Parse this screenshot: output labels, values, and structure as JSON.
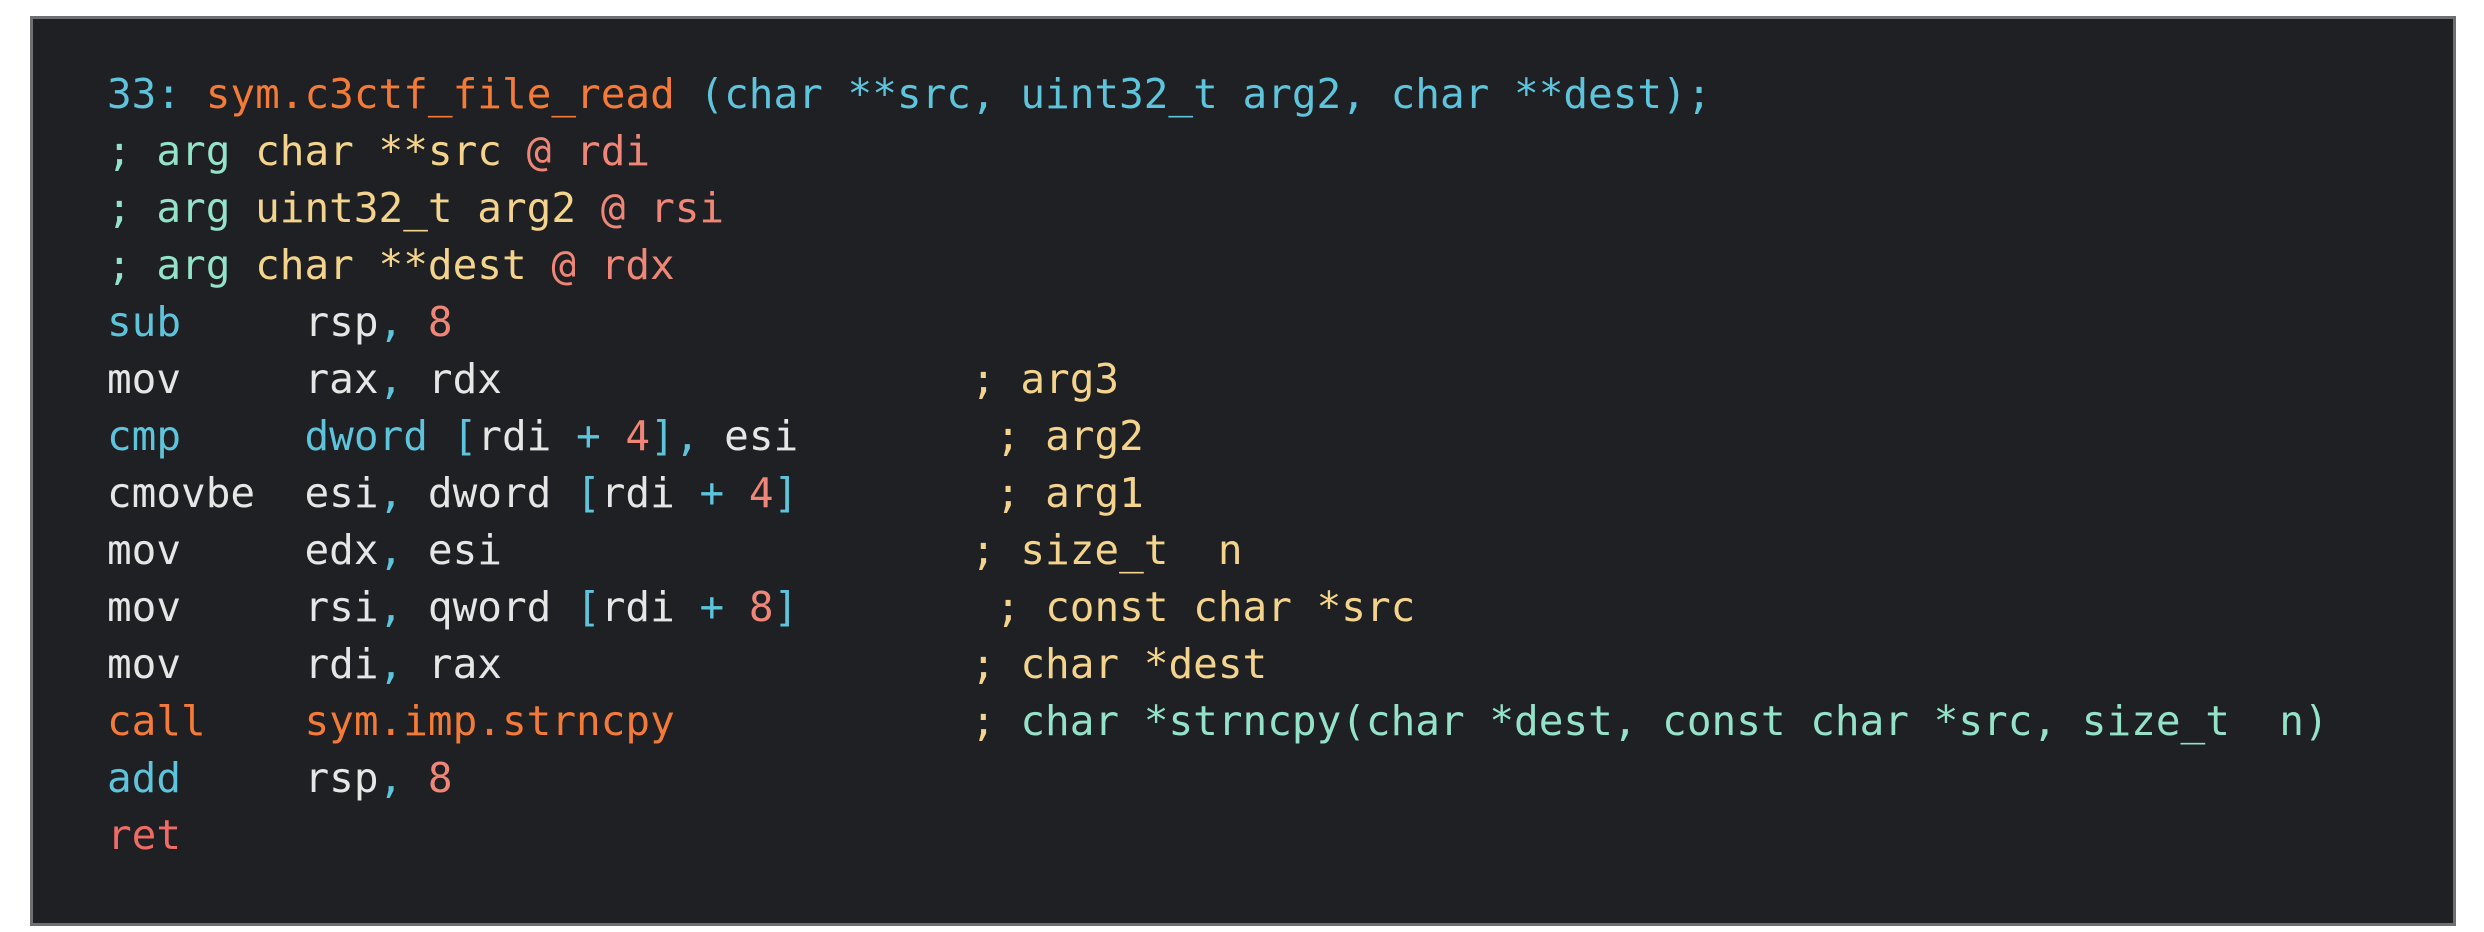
{
  "colors": {
    "background": "#1e2023",
    "border": "#6d6f72",
    "cyan": "#5ec4dc",
    "orange": "#f47a38",
    "white": "#e6e6e6",
    "mint": "#94e2c8",
    "yellow": "#f4d48c",
    "salmon": "#ef8677",
    "red": "#ee6b66"
  },
  "disassembly": {
    "lines": [
      {
        "kind": "header",
        "tokens": [
          {
            "text": "33: ",
            "color": "cyan"
          },
          {
            "text": "sym.c3ctf_file_read",
            "color": "orange"
          },
          {
            "text": " (char **src, uint32_t arg2, char **dest);",
            "color": "cyan"
          }
        ]
      },
      {
        "kind": "arg",
        "tokens": [
          {
            "text": "; arg ",
            "color": "mint"
          },
          {
            "text": "char **src",
            "color": "yellow"
          },
          {
            "text": " @ rdi",
            "color": "salmon"
          }
        ]
      },
      {
        "kind": "arg",
        "tokens": [
          {
            "text": "; arg ",
            "color": "mint"
          },
          {
            "text": "uint32_t arg2",
            "color": "yellow"
          },
          {
            "text": " @ rsi",
            "color": "salmon"
          }
        ]
      },
      {
        "kind": "arg",
        "tokens": [
          {
            "text": "; arg ",
            "color": "mint"
          },
          {
            "text": "char **dest",
            "color": "yellow"
          },
          {
            "text": " @ rdx",
            "color": "salmon"
          }
        ]
      },
      {
        "kind": "instruction",
        "tokens": [
          {
            "text": "sub",
            "color": "cyan"
          },
          {
            "text": "     ",
            "color": "white"
          },
          {
            "text": "rsp",
            "color": "white"
          },
          {
            "text": ", ",
            "color": "cyan"
          },
          {
            "text": "8",
            "color": "salmon"
          }
        ]
      },
      {
        "kind": "instruction",
        "tokens": [
          {
            "text": "mov",
            "color": "white"
          },
          {
            "text": "     ",
            "color": "white"
          },
          {
            "text": "rax",
            "color": "white"
          },
          {
            "text": ", ",
            "color": "cyan"
          },
          {
            "text": "rdx",
            "color": "white"
          },
          {
            "text": "                   ",
            "color": "white"
          },
          {
            "text": "; ",
            "color": "yellow"
          },
          {
            "text": "arg3",
            "color": "yellow"
          }
        ]
      },
      {
        "kind": "instruction",
        "tokens": [
          {
            "text": "cmp",
            "color": "cyan"
          },
          {
            "text": "     ",
            "color": "white"
          },
          {
            "text": "dword",
            "color": "cyan"
          },
          {
            "text": " [",
            "color": "cyan"
          },
          {
            "text": "rdi",
            "color": "white"
          },
          {
            "text": " + ",
            "color": "cyan"
          },
          {
            "text": "4",
            "color": "salmon"
          },
          {
            "text": "], ",
            "color": "cyan"
          },
          {
            "text": "esi",
            "color": "white"
          },
          {
            "text": "        ",
            "color": "white"
          },
          {
            "text": "; ",
            "color": "yellow"
          },
          {
            "text": "arg2",
            "color": "yellow"
          }
        ]
      },
      {
        "kind": "instruction",
        "tokens": [
          {
            "text": "cmovbe",
            "color": "white"
          },
          {
            "text": "  ",
            "color": "white"
          },
          {
            "text": "esi",
            "color": "white"
          },
          {
            "text": ", ",
            "color": "cyan"
          },
          {
            "text": "dword",
            "color": "white"
          },
          {
            "text": " [",
            "color": "cyan"
          },
          {
            "text": "rdi",
            "color": "white"
          },
          {
            "text": " + ",
            "color": "cyan"
          },
          {
            "text": "4",
            "color": "salmon"
          },
          {
            "text": "]",
            "color": "cyan"
          },
          {
            "text": "        ",
            "color": "white"
          },
          {
            "text": "; ",
            "color": "yellow"
          },
          {
            "text": "arg1",
            "color": "yellow"
          }
        ]
      },
      {
        "kind": "instruction",
        "tokens": [
          {
            "text": "mov",
            "color": "white"
          },
          {
            "text": "     ",
            "color": "white"
          },
          {
            "text": "edx",
            "color": "white"
          },
          {
            "text": ", ",
            "color": "cyan"
          },
          {
            "text": "esi",
            "color": "white"
          },
          {
            "text": "                   ",
            "color": "white"
          },
          {
            "text": "; ",
            "color": "yellow"
          },
          {
            "text": "size_t  n",
            "color": "yellow"
          }
        ]
      },
      {
        "kind": "instruction",
        "tokens": [
          {
            "text": "mov",
            "color": "white"
          },
          {
            "text": "     ",
            "color": "white"
          },
          {
            "text": "rsi",
            "color": "white"
          },
          {
            "text": ", ",
            "color": "cyan"
          },
          {
            "text": "qword",
            "color": "white"
          },
          {
            "text": " [",
            "color": "cyan"
          },
          {
            "text": "rdi",
            "color": "white"
          },
          {
            "text": " + ",
            "color": "cyan"
          },
          {
            "text": "8",
            "color": "salmon"
          },
          {
            "text": "]",
            "color": "cyan"
          },
          {
            "text": "        ",
            "color": "white"
          },
          {
            "text": "; ",
            "color": "yellow"
          },
          {
            "text": "const char *src",
            "color": "yellow"
          }
        ]
      },
      {
        "kind": "instruction",
        "tokens": [
          {
            "text": "mov",
            "color": "white"
          },
          {
            "text": "     ",
            "color": "white"
          },
          {
            "text": "rdi",
            "color": "white"
          },
          {
            "text": ", ",
            "color": "cyan"
          },
          {
            "text": "rax",
            "color": "white"
          },
          {
            "text": "                   ",
            "color": "white"
          },
          {
            "text": "; ",
            "color": "yellow"
          },
          {
            "text": "char *dest",
            "color": "yellow"
          }
        ]
      },
      {
        "kind": "instruction",
        "tokens": [
          {
            "text": "call",
            "color": "orange"
          },
          {
            "text": "    ",
            "color": "white"
          },
          {
            "text": "sym.imp.strncpy",
            "color": "orange"
          },
          {
            "text": "            ",
            "color": "white"
          },
          {
            "text": "; ",
            "color": "yellow"
          },
          {
            "text": "char *strncpy(char *dest, const char *src, size_t  n)",
            "color": "mint"
          }
        ]
      },
      {
        "kind": "instruction",
        "tokens": [
          {
            "text": "add",
            "color": "cyan"
          },
          {
            "text": "     ",
            "color": "white"
          },
          {
            "text": "rsp",
            "color": "white"
          },
          {
            "text": ", ",
            "color": "cyan"
          },
          {
            "text": "8",
            "color": "salmon"
          }
        ]
      },
      {
        "kind": "instruction",
        "tokens": [
          {
            "text": "ret",
            "color": "red"
          }
        ]
      }
    ]
  }
}
